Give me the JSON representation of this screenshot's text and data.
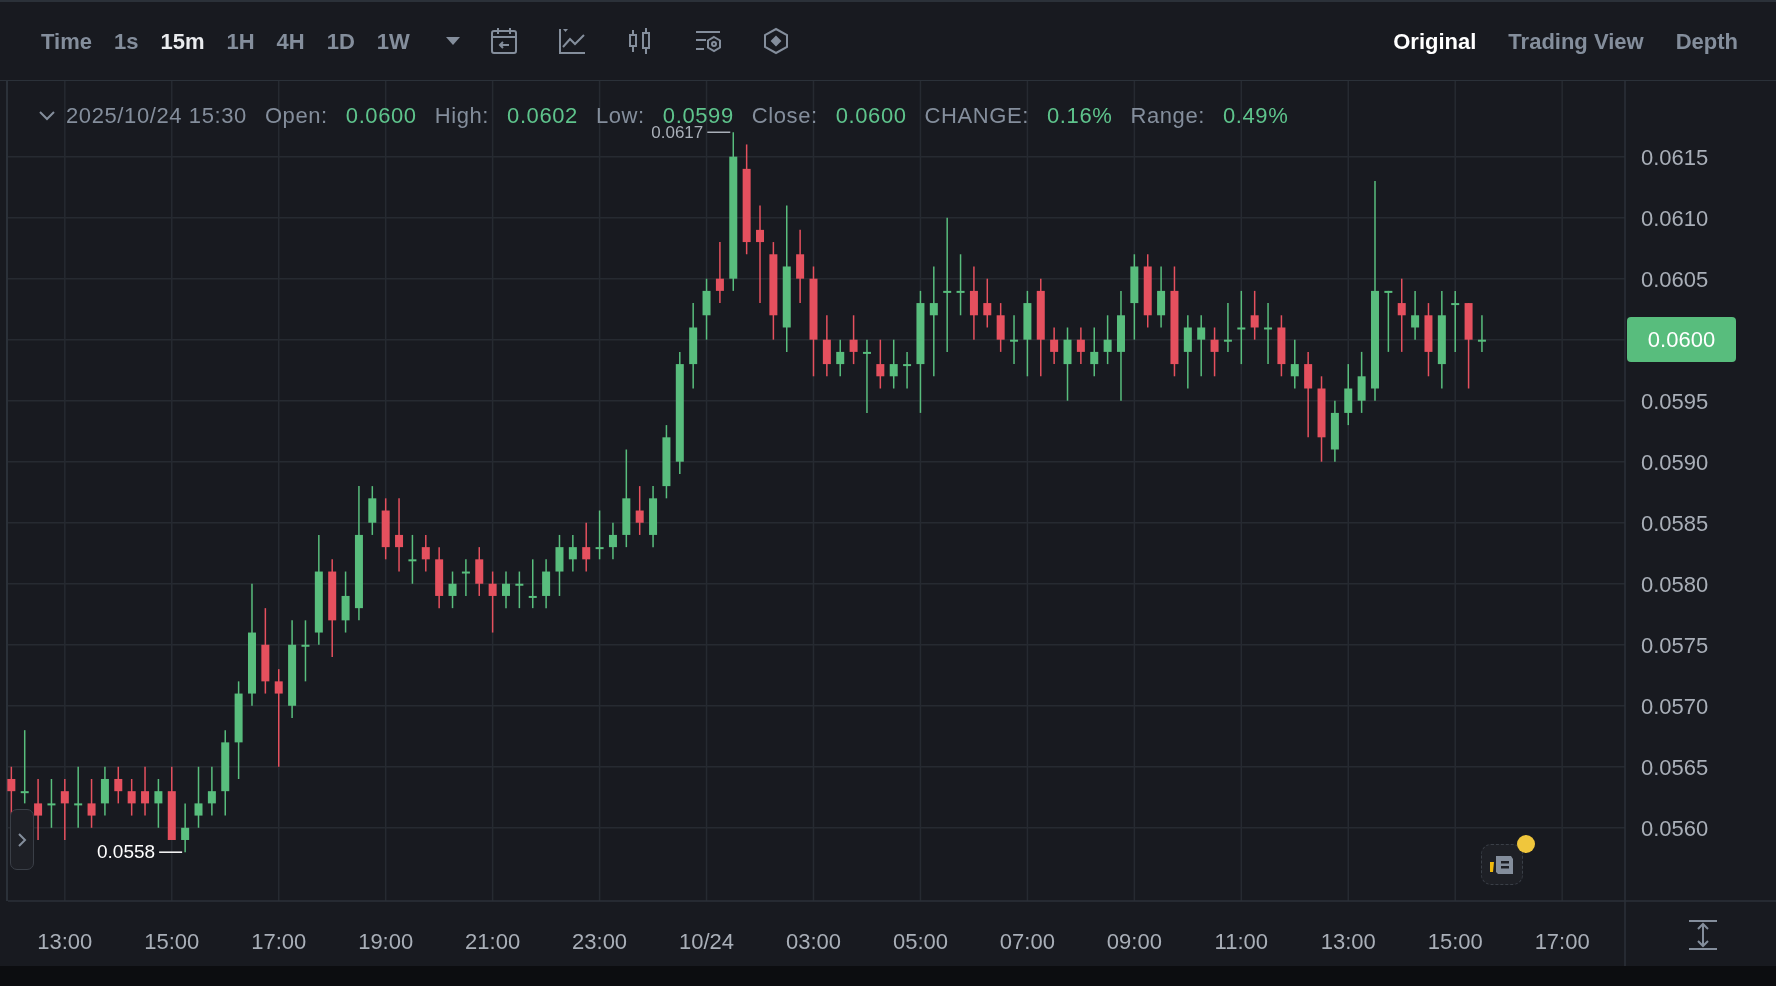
{
  "toolbar": {
    "intervals": [
      {
        "label": "Time",
        "selected": false
      },
      {
        "label": "1s",
        "selected": false
      },
      {
        "label": "15m",
        "selected": true
      },
      {
        "label": "1H",
        "selected": false
      },
      {
        "label": "4H",
        "selected": false
      },
      {
        "label": "1D",
        "selected": false
      },
      {
        "label": "1W",
        "selected": false
      }
    ],
    "views": [
      {
        "label": "Original",
        "selected": true
      },
      {
        "label": "Trading View",
        "selected": false
      },
      {
        "label": "Depth",
        "selected": false
      }
    ]
  },
  "ohlc_header": {
    "date": "2025/10/24 15:30",
    "fields": [
      {
        "label": "Open:",
        "value": "0.0600"
      },
      {
        "label": "High:",
        "value": "0.0602"
      },
      {
        "label": "Low:",
        "value": "0.0599"
      },
      {
        "label": "Close:",
        "value": "0.0600"
      },
      {
        "label": "CHANGE:",
        "value": "0.16%"
      },
      {
        "label": "Range:",
        "value": "0.49%"
      }
    ]
  },
  "chart": {
    "high_marker": "0.0617",
    "low_marker": "0.0558",
    "last_price": "0.0600",
    "price_axis": [
      "0.0615",
      "0.0610",
      "0.0605",
      "0.0595",
      "0.0590",
      "0.0585",
      "0.0580",
      "0.0575",
      "0.0570",
      "0.0565",
      "0.0560"
    ],
    "time_axis": [
      "13:00",
      "15:00",
      "17:00",
      "19:00",
      "21:00",
      "23:00",
      "10/24",
      "03:00",
      "05:00",
      "07:00",
      "09:00",
      "11:00",
      "13:00",
      "15:00",
      "17:00"
    ]
  }
}
